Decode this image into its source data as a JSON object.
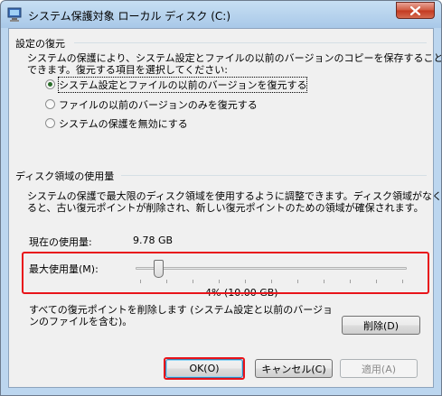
{
  "window": {
    "title": "システム保護対象 ローカル ディスク (C:)"
  },
  "restore_settings": {
    "group_title": "設定の復元",
    "description_line1": "システムの保護により、システム設定とファイルの以前のバージョンのコピーを保存することが",
    "description_line2": "できます。復元する項目を選択してください:",
    "options": [
      {
        "label": "システム設定とファイルの以前のバージョンを復元する",
        "selected": true
      },
      {
        "label": "ファイルの以前のバージョンのみを復元する",
        "selected": false
      },
      {
        "label": "システムの保護を無効にする",
        "selected": false
      }
    ]
  },
  "disk_usage": {
    "group_title": "ディスク領域の使用量",
    "description_line1": "システムの保護で最大限のディスク領域を使用するように調整できます。ディスク領域がなくな",
    "description_line2": "ると、古い復元ポイントが削除され、新しい復元ポイントのための領域が確保されます。",
    "current_label": "現在の使用量:",
    "current_value": "9.78 GB",
    "max_label": "最大使用量(M):",
    "max_value": "4% (10.00 GB)",
    "slider_fraction": 0.04,
    "delete_text_line1": "すべての復元ポイントを削除します (システム設定と以前のバージョ",
    "delete_text_line2": "ンのファイルを含む)。",
    "delete_button": "削除(D)"
  },
  "buttons": {
    "ok": "OK(O)",
    "cancel": "キャンセル(C)",
    "apply": "適用(A)"
  },
  "colors": {
    "highlight": "#e8141a",
    "titlebar": "#a9c8e8",
    "close_button": "#c3381f"
  }
}
